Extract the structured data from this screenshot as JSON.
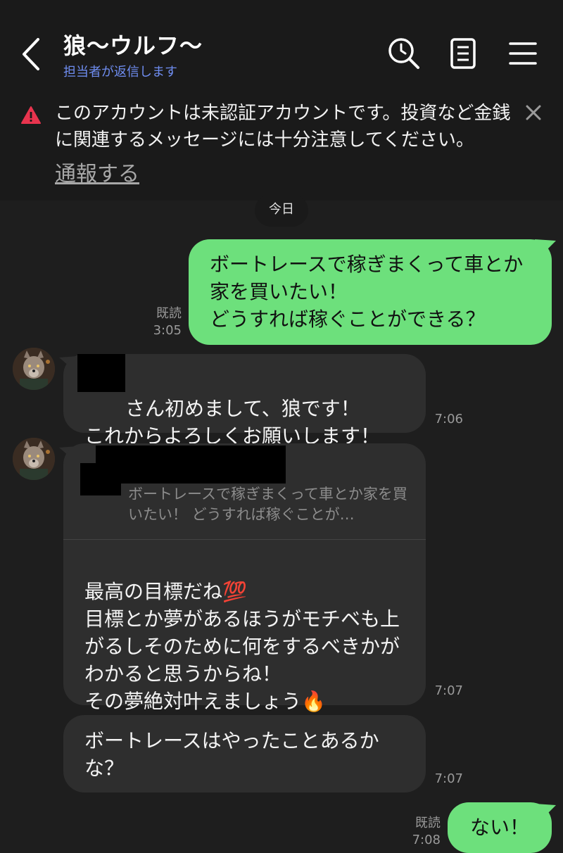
{
  "header": {
    "title": "狼～ウルフ～",
    "subtitle": "担当者が返信します"
  },
  "warning": {
    "text": "このアカウントは未認証アカウントです。投資など金銭に関連するメッセージには十分注意してください。",
    "report_label": "通報する"
  },
  "date_label": "今日",
  "messages": [
    {
      "text": "ボートレースで稼ぎまくって車とか家を買いたい！\nどうすれば稼ぐことができる？",
      "read": "既読",
      "time": "3:05"
    },
    {
      "text": "さん初めまして、狼です！\nこれからよろしくお願いします！",
      "time": "7:06"
    },
    {
      "quote": "ボートレースで稼ぎまくって車とか家を買いたい！ どうすれば稼ぐことが…",
      "text": "最高の目標だね💯\n目標とか夢があるほうがモチベも上がるしそのために何をするべきかがわかると思うからね！\nその夢絶対叶えましょう🔥",
      "time": "7:07"
    },
    {
      "text": "ボートレースはやったことあるかな？",
      "time": "7:07"
    },
    {
      "text": "ない！",
      "read": "既読",
      "time": "7:08"
    }
  ],
  "colors": {
    "background": "#1e1e1e",
    "header": "#1a1a1a",
    "outgoing_bubble": "#6de07c",
    "incoming_bubble": "#2e2e2e",
    "subtitle": "#6f8df0",
    "warning_icon": "#e8344e"
  },
  "icons": [
    "back-icon",
    "search-icon",
    "notes-icon",
    "menu-icon",
    "warning-icon",
    "close-icon"
  ]
}
